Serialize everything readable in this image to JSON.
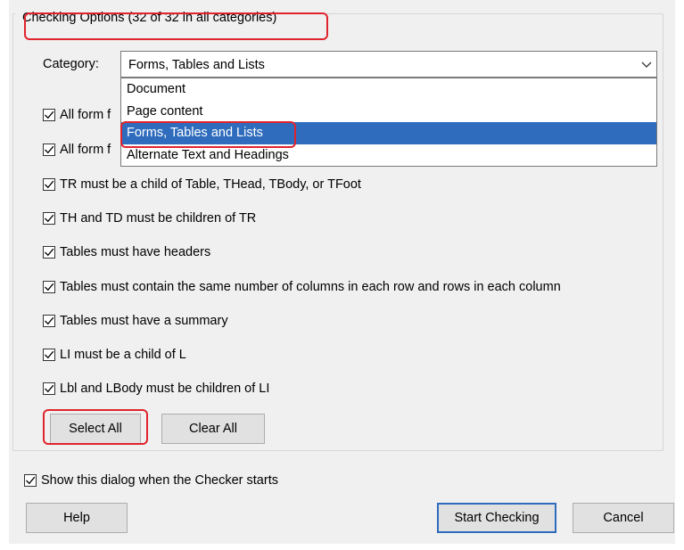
{
  "group": {
    "title": "Checking Options (32 of 32 in all categories)"
  },
  "category": {
    "label": "Category:",
    "selected_value": "Forms, Tables and Lists",
    "options": [
      "Document",
      "Page content",
      "Forms, Tables and Lists",
      "Alternate Text and Headings"
    ]
  },
  "checks": [
    {
      "label": "All form f",
      "checked": true
    },
    {
      "label": "All form f",
      "checked": true
    },
    {
      "label": "TR must be a child of Table, THead, TBody, or TFoot",
      "checked": true
    },
    {
      "label": "TH and TD must be children of TR",
      "checked": true
    },
    {
      "label": "Tables must have headers",
      "checked": true
    },
    {
      "label": "Tables must contain the same number of columns in each row and rows in each column",
      "checked": true
    },
    {
      "label": "Tables must have a summary",
      "checked": true
    },
    {
      "label": "LI must be a child of L",
      "checked": true
    },
    {
      "label": "Lbl and LBody must be children of LI",
      "checked": true
    }
  ],
  "buttons": {
    "select_all": "Select All",
    "clear_all": "Clear All",
    "help": "Help",
    "start_checking": "Start Checking",
    "cancel": "Cancel"
  },
  "show_dialog": {
    "label": "Show this dialog when the Checker starts",
    "checked": true
  },
  "colors": {
    "highlight": "#e0242d",
    "selection": "#2f6cbd"
  }
}
